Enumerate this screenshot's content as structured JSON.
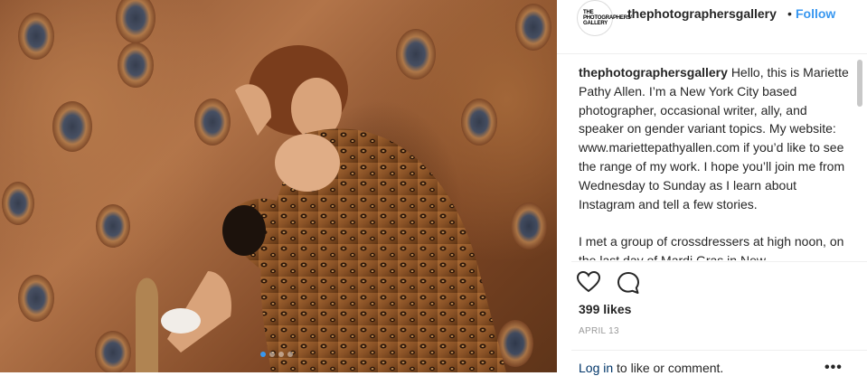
{
  "post": {
    "photo_alt": "photograph",
    "carousel": {
      "count": 4,
      "active_index": 0
    }
  },
  "header": {
    "avatar_text": [
      "THE",
      "PHOTOGRAPHERS'",
      "GALLERY"
    ],
    "username": "thephotographersgallery",
    "separator": "•",
    "follow_label": "Follow"
  },
  "caption": {
    "username": "thephotographersgallery",
    "paragraph1": "Hello, this is Mariette Pathy Allen. I’m a New York City based photographer, occasional writer, ally, and speaker on gender variant topics. My website: www.mariettepathyallen.com if you’d like to see the range of my work. I hope you’ll join me from Wednesday to Sunday as I learn about Instagram and tell a few stories.",
    "paragraph2": "I met a group of crossdressers at high noon, on the last day of Mardi Gras in New"
  },
  "actions": {
    "like_icon": "heart-icon",
    "comment_icon": "comment-icon",
    "likes_text": "399 likes",
    "date": "APRIL 13"
  },
  "footer": {
    "login_link": "Log in",
    "login_rest": " to like or comment.",
    "more_label": "•••"
  },
  "colors": {
    "accent": "#3897f0",
    "text": "#262626",
    "muted": "#999999",
    "divider": "#efefef"
  }
}
